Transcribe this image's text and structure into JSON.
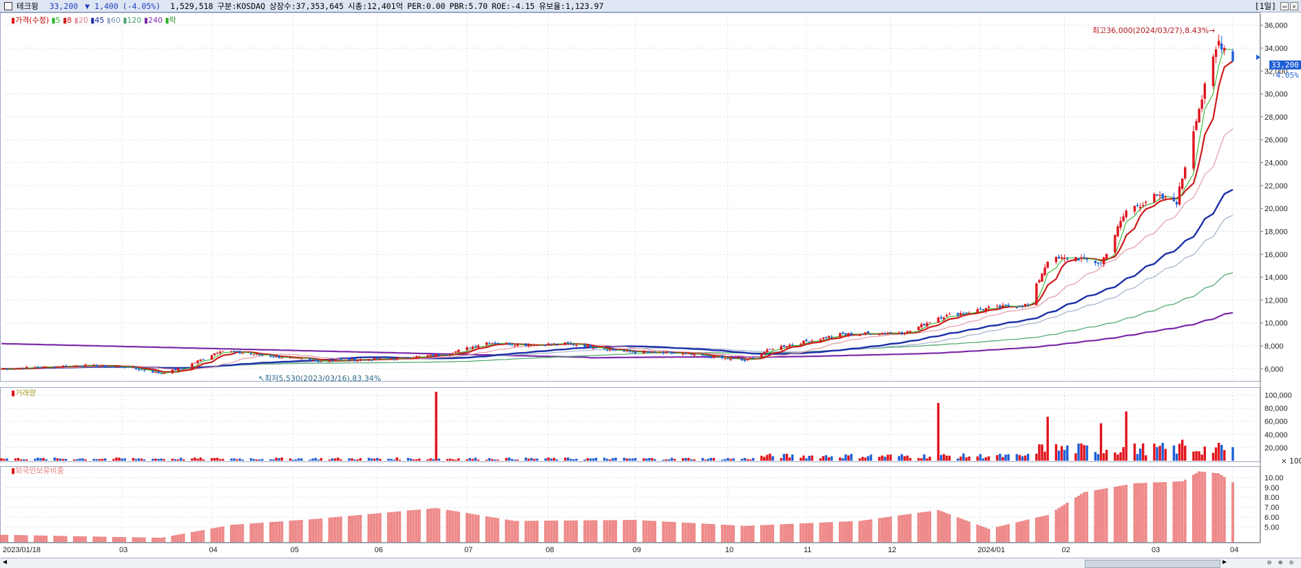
{
  "header": {
    "name": "테크윙",
    "price": "33,200",
    "change": "▼ 1,400",
    "change_pct": "(-4.05%)",
    "volume": "1,529,518",
    "market": "구분:KOSDAQ",
    "shares": "상장수:37,353,645",
    "mktcap": "시총:12,401억",
    "per": "PER:0.00",
    "pbr": "PBR:5.70",
    "roe": "ROE:-4.15",
    "float": "유보율:1,123.97",
    "period": "[1일]"
  },
  "colors": {
    "up": "#e0141c",
    "down": "#1f5fd6",
    "ma5": "#2bb52b",
    "ma8": "#cc1a1a",
    "ma20": "#e39aa6",
    "ma45": "#1a2fa8",
    "ma60": "#9fb0c8",
    "ma120": "#46a46a",
    "ma240": "#7a2aa8",
    "foreign": "#f08a8a"
  },
  "legend": {
    "price": "가격(수정)",
    "ma5": "5",
    "ma8": "8",
    "ma20": "20",
    "ma45": "45",
    "ma60": "60",
    "ma120": "120",
    "ma240": "240",
    "event": "락"
  },
  "annotations": {
    "high": "최고36,000(2024/03/27),8.43%",
    "low": "최저5,530(2023/03/16),83.34%",
    "last_price": "33,200",
    "last_pct": "-4.05%"
  },
  "volume_pane": {
    "title": "거래량",
    "unit": "× 100"
  },
  "foreign_pane": {
    "title": "외국인보유비중"
  },
  "chart_data": [
    {
      "type": "candlestick",
      "x_labels": [
        "2023/01/18",
        "03",
        "04",
        "05",
        "06",
        "07",
        "08",
        "09",
        "10",
        "11",
        "12",
        "2024/01",
        "02",
        "03",
        "04"
      ],
      "y_ticks": [
        6000,
        8000,
        10000,
        12000,
        14000,
        16000,
        18000,
        20000,
        22000,
        24000,
        26000,
        28000,
        30000,
        32000,
        34000,
        36000
      ],
      "ylim": [
        5000,
        37000
      ],
      "close_keypoints": [
        {
          "x": "2023/01/18",
          "y": 6000
        },
        {
          "x": "2023/02/15",
          "y": 6300
        },
        {
          "x": "2023/03/02",
          "y": 6200
        },
        {
          "x": "2023/03/16",
          "y": 5600
        },
        {
          "x": "2023/03/24",
          "y": 6100
        },
        {
          "x": "2023/04/06",
          "y": 7600
        },
        {
          "x": "2023/04/20",
          "y": 7200
        },
        {
          "x": "2023/05/10",
          "y": 6700
        },
        {
          "x": "2023/06/08",
          "y": 6900
        },
        {
          "x": "2023/06/26",
          "y": 7300
        },
        {
          "x": "2023/07/10",
          "y": 8300
        },
        {
          "x": "2023/07/24",
          "y": 8100
        },
        {
          "x": "2023/08/08",
          "y": 8200
        },
        {
          "x": "2023/08/28",
          "y": 7500
        },
        {
          "x": "2023/09/18",
          "y": 7300
        },
        {
          "x": "2023/10/10",
          "y": 6700
        },
        {
          "x": "2023/10/20",
          "y": 7800
        },
        {
          "x": "2023/11/13",
          "y": 9000
        },
        {
          "x": "2023/12/07",
          "y": 9200
        },
        {
          "x": "2023/12/18",
          "y": 10500
        },
        {
          "x": "2024/01/05",
          "y": 11300
        },
        {
          "x": "2024/01/19",
          "y": 11600
        },
        {
          "x": "2024/01/26",
          "y": 15500
        },
        {
          "x": "2024/02/05",
          "y": 15700
        },
        {
          "x": "2024/02/14",
          "y": 15200
        },
        {
          "x": "2024/02/23",
          "y": 19800
        },
        {
          "x": "2024/03/04",
          "y": 21000
        },
        {
          "x": "2024/03/12",
          "y": 20600
        },
        {
          "x": "2024/03/19",
          "y": 28000
        },
        {
          "x": "2024/03/27",
          "y": 34600
        },
        {
          "x": "2024/04/01",
          "y": 33200
        }
      ]
    },
    {
      "type": "bar",
      "name": "거래량",
      "y_ticks": [
        20000,
        40000,
        60000,
        80000,
        100000
      ],
      "ylim": [
        0,
        110000
      ],
      "spikes": [
        {
          "x": "2023/06/22",
          "y": 105000
        },
        {
          "x": "2023/12/18",
          "y": 88000
        },
        {
          "x": "2024/01/26",
          "y": 67000
        },
        {
          "x": "2024/02/14",
          "y": 57000
        },
        {
          "x": "2024/02/23",
          "y": 75000
        },
        {
          "x": "2024/03/14",
          "y": 32000
        }
      ]
    },
    {
      "type": "bar",
      "name": "외국인보유비중",
      "y_ticks": [
        5,
        6,
        7,
        8,
        9,
        10
      ],
      "ylim": [
        3.5,
        11
      ],
      "keypoints": [
        {
          "x": "2023/01/18",
          "y": 4.2
        },
        {
          "x": "2023/03/16",
          "y": 3.9
        },
        {
          "x": "2023/04/10",
          "y": 5.2
        },
        {
          "x": "2023/05/10",
          "y": 5.8
        },
        {
          "x": "2023/06/22",
          "y": 6.9
        },
        {
          "x": "2023/07/20",
          "y": 5.6
        },
        {
          "x": "2023/09/01",
          "y": 5.7
        },
        {
          "x": "2023/10/10",
          "y": 5.1
        },
        {
          "x": "2023/11/20",
          "y": 5.6
        },
        {
          "x": "2023/12/18",
          "y": 6.7
        },
        {
          "x": "2024/01/05",
          "y": 4.8
        },
        {
          "x": "2024/01/26",
          "y": 6.2
        },
        {
          "x": "2024/02/08",
          "y": 8.5
        },
        {
          "x": "2024/02/26",
          "y": 9.4
        },
        {
          "x": "2024/03/14",
          "y": 9.6
        },
        {
          "x": "2024/03/20",
          "y": 10.6
        },
        {
          "x": "2024/03/27",
          "y": 10.4
        },
        {
          "x": "2024/04/01",
          "y": 9.5
        }
      ]
    }
  ]
}
